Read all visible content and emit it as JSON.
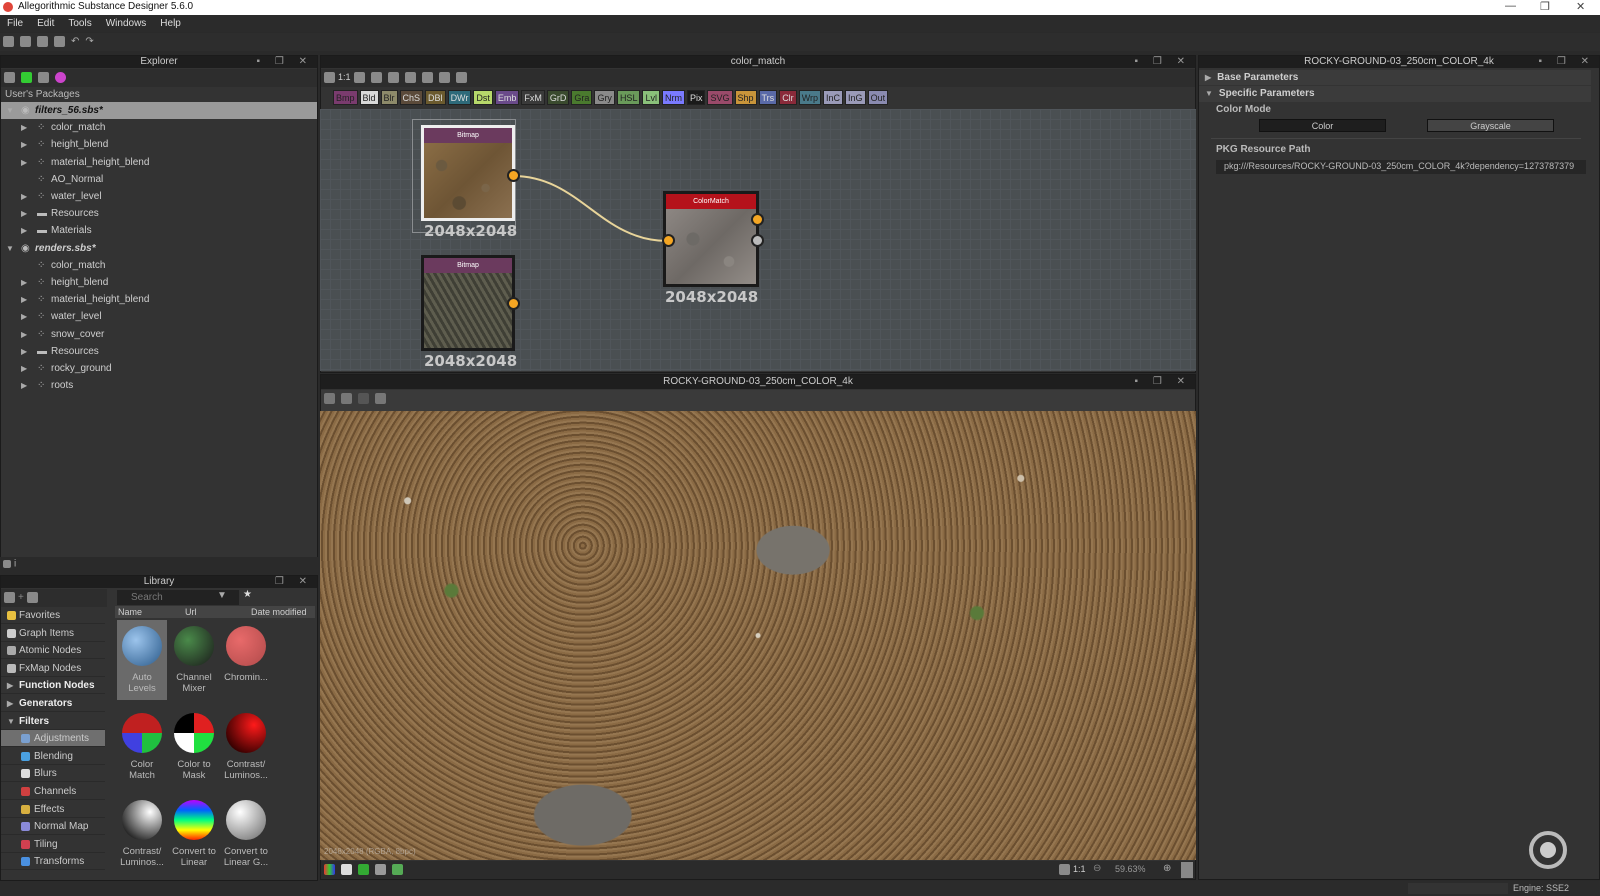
{
  "app": {
    "title": "Allegorithmic Substance Designer 5.6.0",
    "menu": [
      "File",
      "Edit",
      "Tools",
      "Windows",
      "Help"
    ],
    "window_controls": [
      "—",
      "❐",
      "✕"
    ]
  },
  "explorer": {
    "title": "Explorer",
    "section": "User's Packages",
    "tree": [
      {
        "label": "filters_56.sbs*",
        "type": "package",
        "expanded": true,
        "selected": true
      },
      {
        "label": "color_match",
        "type": "graph",
        "arrow": true
      },
      {
        "label": "height_blend",
        "type": "graph",
        "arrow": true
      },
      {
        "label": "material_height_blend",
        "type": "graph",
        "arrow": true
      },
      {
        "label": "AO_Normal",
        "type": "graph",
        "arrow": false
      },
      {
        "label": "water_level",
        "type": "graph",
        "arrow": true
      },
      {
        "label": "Resources",
        "type": "folder",
        "arrow": true
      },
      {
        "label": "Materials",
        "type": "folder",
        "arrow": true
      },
      {
        "label": "renders.sbs*",
        "type": "package",
        "expanded": true
      },
      {
        "label": "color_match",
        "type": "graph",
        "arrow": false
      },
      {
        "label": "height_blend",
        "type": "graph",
        "arrow": true
      },
      {
        "label": "material_height_blend",
        "type": "graph",
        "arrow": true
      },
      {
        "label": "water_level",
        "type": "graph",
        "arrow": true
      },
      {
        "label": "snow_cover",
        "type": "graph",
        "arrow": true
      },
      {
        "label": "Resources",
        "type": "folder",
        "arrow": true
      },
      {
        "label": "rocky_ground",
        "type": "graph",
        "arrow": true
      },
      {
        "label": "roots",
        "type": "graph",
        "arrow": true
      }
    ]
  },
  "graph": {
    "title": "color_match",
    "toolbar_zoom": "1:1",
    "palette": [
      {
        "l": "Bmp",
        "c": "#7a3b6e"
      },
      {
        "l": "Bld",
        "c": "#d8d8d8"
      },
      {
        "l": "Blr",
        "c": "#8d8a6a"
      },
      {
        "l": "ChS",
        "c": "#5b4a3a"
      },
      {
        "l": "DBl",
        "c": "#6b5a2e"
      },
      {
        "l": "DWr",
        "c": "#2e6a7a"
      },
      {
        "l": "Dst",
        "c": "#b7d86a"
      },
      {
        "l": "Emb",
        "c": "#6a4a8a"
      },
      {
        "l": "FxM",
        "c": "#3a3a3a"
      },
      {
        "l": "GrD",
        "c": "#3a4a2e"
      },
      {
        "l": "Gra",
        "c": "#4a7a2e"
      },
      {
        "l": "Gry",
        "c": "#8a8a8a"
      },
      {
        "l": "HSL",
        "c": "#6a9a5a"
      },
      {
        "l": "Lvl",
        "c": "#8ac07a"
      },
      {
        "l": "Nrm",
        "c": "#7a7aff"
      },
      {
        "l": "Pix",
        "c": "#1a1a1a"
      },
      {
        "l": "SVG",
        "c": "#9a4a6a"
      },
      {
        "l": "Shp",
        "c": "#c8943a"
      },
      {
        "l": "Trs",
        "c": "#5a6aa8"
      },
      {
        "l": "Clr",
        "c": "#8a2a3a"
      },
      {
        "l": "Wrp",
        "c": "#4a7a8a"
      },
      {
        "l": "InC",
        "c": "#9a9ab8"
      },
      {
        "l": "InG",
        "c": "#9a9ab8"
      },
      {
        "l": "Out",
        "c": "#8a8ab0"
      }
    ],
    "nodes": [
      {
        "header": "Bitmap",
        "resolution": "2048x2048",
        "color": "#6b3a5e"
      },
      {
        "header": "Bitmap",
        "resolution": "2048x2048",
        "color": "#6b3a5e"
      },
      {
        "header": "ColorMatch",
        "resolution": "2048x2048",
        "color": "#b5121b"
      }
    ]
  },
  "viewport": {
    "title": "ROCKY-GROUND-03_250cm_COLOR_4k",
    "overlay": "2048x2048 (RGBA, 8bpc)",
    "zoom_fit": "1:1",
    "zoom": "59.63%"
  },
  "properties": {
    "title": "ROCKY-GROUND-03_250cm_COLOR_4k",
    "base": "Base Parameters",
    "specific": "Specific Parameters",
    "color_mode_label": "Color Mode",
    "color_mode_options": [
      "Color",
      "Grayscale"
    ],
    "color_mode_selected": "Color",
    "pkg_label": "PKG Resource Path",
    "pkg_value": "pkg:///Resources/ROCKY-GROUND-03_250cm_COLOR_4k?dependency=1273787379"
  },
  "library": {
    "title": "Library",
    "search_placeholder": "Search",
    "columns": [
      "Name",
      "Url",
      "Date modified"
    ],
    "categories": [
      {
        "l": "Favorites",
        "c": "#e8c040"
      },
      {
        "l": "Graph Items",
        "c": "#ccc"
      },
      {
        "l": "Atomic Nodes",
        "c": "#aaa"
      },
      {
        "l": "FxMap Nodes",
        "c": "#bbb"
      },
      {
        "l": "Function Nodes",
        "bold": true,
        "arrow": "▶"
      },
      {
        "l": "Generators",
        "bold": true,
        "arrow": "▶"
      },
      {
        "l": "Filters",
        "bold": true,
        "arrow": "▼"
      },
      {
        "l": "Adjustments",
        "c": "#7aa0d0",
        "sub": true,
        "sel": true
      },
      {
        "l": "Blending",
        "c": "#4aa0e0",
        "sub": true
      },
      {
        "l": "Blurs",
        "c": "#ddd",
        "sub": true
      },
      {
        "l": "Channels",
        "c": "#d04040",
        "sub": true
      },
      {
        "l": "Effects",
        "c": "#d8b040",
        "sub": true
      },
      {
        "l": "Normal Map",
        "c": "#8a8ad8",
        "sub": true
      },
      {
        "l": "Tiling",
        "c": "#d04050",
        "sub": true
      },
      {
        "l": "Transforms",
        "c": "#4a90e0",
        "sub": true
      }
    ],
    "items": [
      {
        "l1": "Auto",
        "l2": "Levels",
        "bg": "radial-gradient(circle at 35% 35%,#9cc4ec,#2a5a8a)",
        "sel": true
      },
      {
        "l1": "Channel",
        "l2": "Mixer",
        "bg": "radial-gradient(circle at 35% 35%,#4a8a4a,#1a1a1a)"
      },
      {
        "l1": "Chromin...",
        "l2": "",
        "bg": "radial-gradient(circle at 35% 35%,#e86a6a,#b04a4a)"
      },
      {
        "l1": "Color",
        "l2": "Match",
        "bg": "conic-gradient(#c02020 0 25%,#20c040 0 50%,#4040e0 0 75%,#c02020 0)"
      },
      {
        "l1": "Color to",
        "l2": "Mask",
        "bg": "conic-gradient(#e02020 0 25%,#20e040 0 50%,#fff 0 75%,#000 0)"
      },
      {
        "l1": "Contrast/",
        "l2": "Luminos...",
        "bg": "radial-gradient(circle at 70% 30%,#ff1a1a,#300 80%)"
      },
      {
        "l1": "Contrast/",
        "l2": "Luminos...",
        "bg": "radial-gradient(circle at 70% 30%,#fff,#222 80%)"
      },
      {
        "l1": "Convert to",
        "l2": "Linear",
        "bg": "linear-gradient(#c000ff,#0060ff,#00ff80,#ffff00,#ff2000)"
      },
      {
        "l1": "Convert to",
        "l2": "Linear G...",
        "bg": "radial-gradient(circle at 35% 30%,#fff,#666)"
      }
    ]
  },
  "status": {
    "engine": "Engine: SSE2"
  }
}
